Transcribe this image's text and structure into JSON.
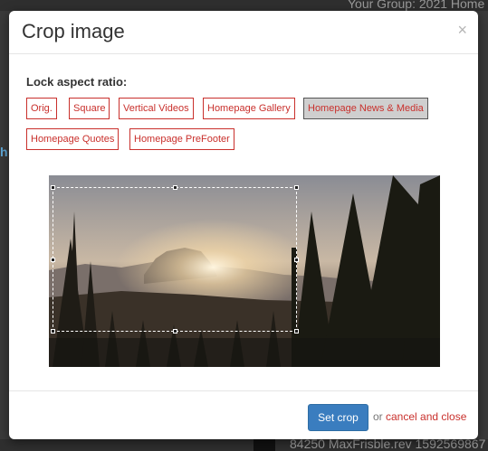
{
  "background": {
    "top_text": "Your Group: 2021 Home",
    "left_glimpse": "h",
    "bottom_text": "84250 MaxFrisble.rev 1592569867"
  },
  "modal": {
    "title": "Crop image",
    "close_symbol": "×",
    "lock_label": "Lock aspect ratio:",
    "ratio_options": [
      {
        "label": "Orig.",
        "active": false
      },
      {
        "label": "Square",
        "active": false
      },
      {
        "label": "Vertical Videos",
        "active": false
      },
      {
        "label": "Homepage Gallery",
        "active": false
      },
      {
        "label": "Homepage News & Media",
        "active": true
      },
      {
        "label": "Homepage Quotes",
        "active": false
      },
      {
        "label": "Homepage PreFooter",
        "active": false
      }
    ],
    "image_alt": "Mountain valley at sunset with pine trees",
    "footer": {
      "set_crop_label": "Set crop",
      "or_text": "or",
      "cancel_label": "cancel and close"
    }
  },
  "colors": {
    "accent_red": "#c9302c",
    "primary_blue": "#3a7dbf",
    "active_gray": "#cfcfcf"
  },
  "icons": {
    "close": "close-icon"
  }
}
